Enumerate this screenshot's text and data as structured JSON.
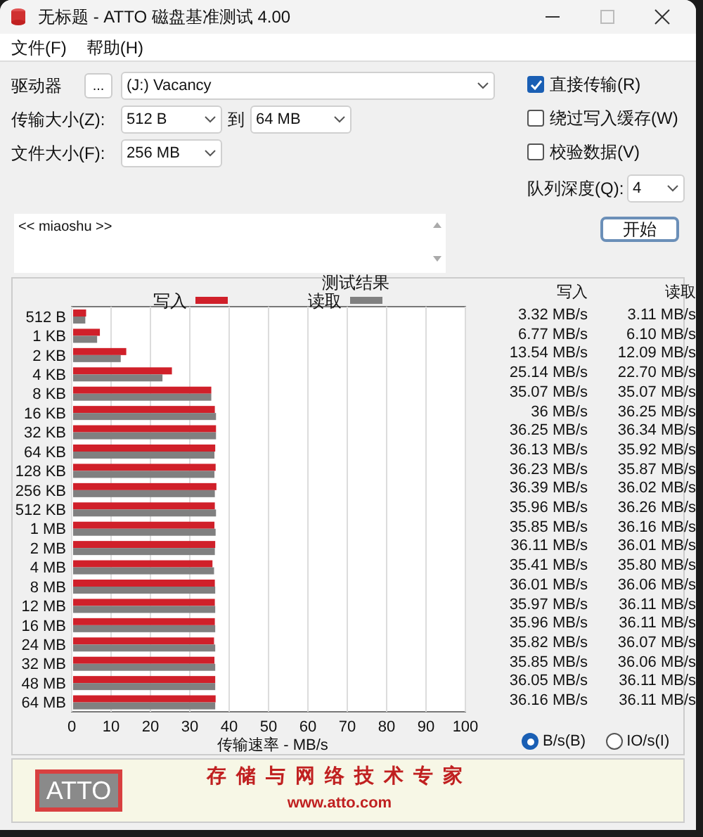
{
  "window": {
    "title": "无标题 - ATTO 磁盘基准测试 4.00"
  },
  "menu": [
    "文件(F)",
    "帮助(H)"
  ],
  "drive": {
    "label": "驱动器",
    "browse": "...",
    "value": "(J:) Vacancy"
  },
  "transfer_size": {
    "label": "传输大小(Z):",
    "from": "512 B",
    "to_label": "到",
    "to": "64 MB"
  },
  "file_size": {
    "label": "文件大小(F):",
    "value": "256 MB"
  },
  "options": [
    {
      "label": "直接传输(R)",
      "checked": true
    },
    {
      "label": "绕过写入缓存(W)",
      "checked": false
    },
    {
      "label": "校验数据(V)",
      "checked": false
    }
  ],
  "queue_depth": {
    "label": "队列深度(Q):",
    "value": "4"
  },
  "start_button": "开始",
  "description": "<< miaoshu >>",
  "results": {
    "title": "测试结果",
    "columns": [
      "写入",
      "读取"
    ],
    "rows": [
      [
        "3.32 MB/s",
        "3.11 MB/s"
      ],
      [
        "6.77 MB/s",
        "6.10 MB/s"
      ],
      [
        "13.54 MB/s",
        "12.09 MB/s"
      ],
      [
        "25.14 MB/s",
        "22.70 MB/s"
      ],
      [
        "35.07 MB/s",
        "35.07 MB/s"
      ],
      [
        "36 MB/s",
        "36.25 MB/s"
      ],
      [
        "36.25 MB/s",
        "36.34 MB/s"
      ],
      [
        "36.13 MB/s",
        "35.92 MB/s"
      ],
      [
        "36.23 MB/s",
        "35.87 MB/s"
      ],
      [
        "36.39 MB/s",
        "36.02 MB/s"
      ],
      [
        "35.96 MB/s",
        "36.26 MB/s"
      ],
      [
        "35.85 MB/s",
        "36.16 MB/s"
      ],
      [
        "36.11 MB/s",
        "36.01 MB/s"
      ],
      [
        "35.41 MB/s",
        "35.80 MB/s"
      ],
      [
        "36.01 MB/s",
        "36.06 MB/s"
      ],
      [
        "35.97 MB/s",
        "36.11 MB/s"
      ],
      [
        "35.96 MB/s",
        "36.11 MB/s"
      ],
      [
        "35.82 MB/s",
        "36.07 MB/s"
      ],
      [
        "35.85 MB/s",
        "36.06 MB/s"
      ],
      [
        "36.05 MB/s",
        "36.11 MB/s"
      ],
      [
        "36.16 MB/s",
        "36.11 MB/s"
      ]
    ],
    "chart_data": {
      "type": "bar",
      "orientation": "horizontal",
      "xlabel": "传输速率 - MB/s",
      "categories": [
        "512 B",
        "1 KB",
        "2 KB",
        "4 KB",
        "8 KB",
        "16 KB",
        "32 KB",
        "64 KB",
        "128 KB",
        "256 KB",
        "512 KB",
        "1 MB",
        "2 MB",
        "4 MB",
        "8 MB",
        "12 MB",
        "16 MB",
        "24 MB",
        "32 MB",
        "48 MB",
        "64 MB"
      ],
      "series": [
        {
          "name": "写入",
          "color": "#d0202a",
          "values": [
            3.3,
            6.8,
            13.5,
            25.1,
            35.1,
            36,
            36.3,
            36.1,
            36.2,
            36.4,
            36,
            35.9,
            36.1,
            35.4,
            36,
            36,
            36,
            35.8,
            35.9,
            36.1,
            36.2
          ]
        },
        {
          "name": "读取",
          "color": "#808080",
          "values": [
            3.1,
            6.1,
            12.1,
            22.7,
            35.1,
            36.3,
            36.3,
            35.9,
            35.9,
            36,
            36.3,
            36.2,
            36,
            35.8,
            36.1,
            36.1,
            36.1,
            36.1,
            36.1,
            36.1,
            36.1
          ]
        }
      ],
      "grid": true,
      "xlim": [
        0,
        100
      ],
      "xticks": [
        0,
        10,
        20,
        30,
        40,
        50,
        60,
        70,
        80,
        90,
        100
      ]
    },
    "units": [
      {
        "label": "B/s(B)",
        "selected": true
      },
      {
        "label": "IO/s(I)",
        "selected": false
      }
    ]
  },
  "banner": {
    "logo": "ATTO",
    "slogan": "存储与网络技术专家",
    "url": "www.atto.com"
  }
}
